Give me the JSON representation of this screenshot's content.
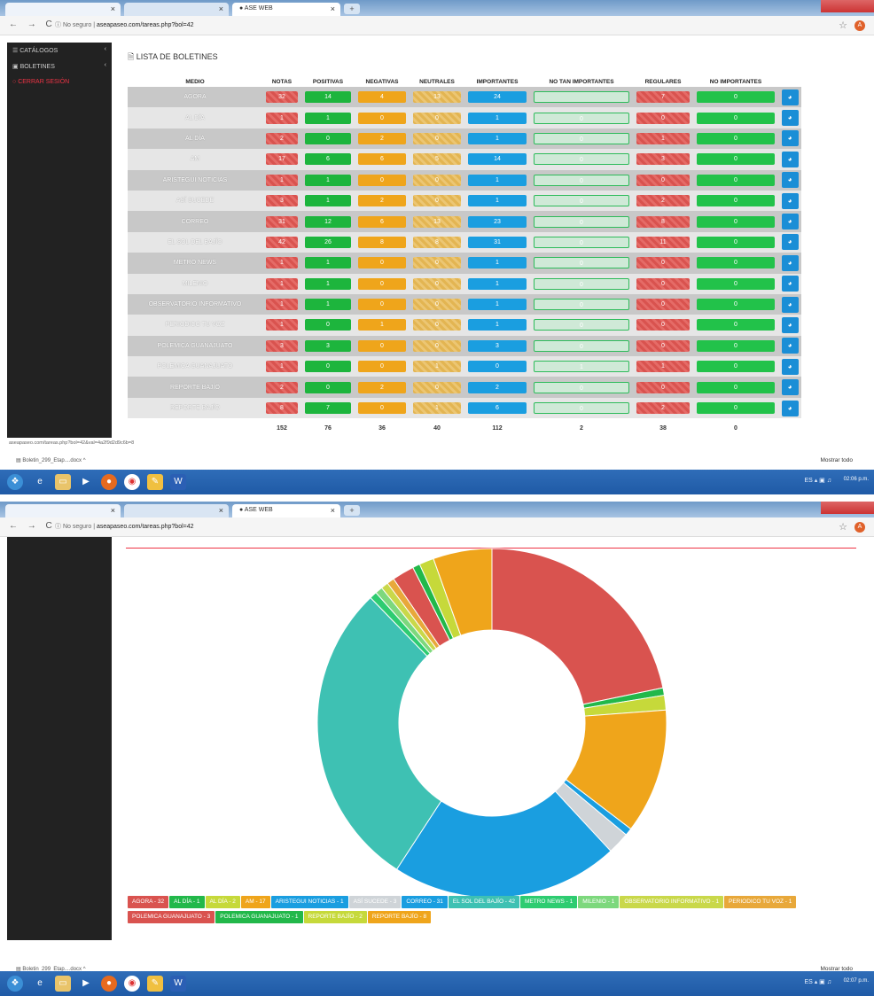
{
  "browser": {
    "tab_title": "ASE WEB",
    "url_prefix": "No seguro | ",
    "url1": "aseapaseo.com/tareas.php?bol=42",
    "url2": "aseapaseo.com/tareas.php?bol=42"
  },
  "sidebar": {
    "items": [
      {
        "label": "CATÁLOGOS"
      },
      {
        "label": "BOLETINES"
      },
      {
        "label": "CERRAR SESIÓN"
      }
    ]
  },
  "page": {
    "title": "LISTA DE BOLETINES"
  },
  "table": {
    "headers": [
      "MEDIO",
      "NOTAS",
      "POSITIVAS",
      "NEGATIVAS",
      "NEUTRALES",
      "IMPORTANTES",
      "NO TAN IMPORTANTES",
      "REGULARES",
      "NO IMPORTANTES"
    ],
    "rows": [
      {
        "medio": "AGORA",
        "vals": [
          "32",
          "14",
          "4",
          "13",
          "24",
          "",
          "7",
          "0"
        ]
      },
      {
        "medio": "AL DÍA",
        "vals": [
          "1",
          "1",
          "0",
          "0",
          "1",
          "0",
          "0",
          "0"
        ]
      },
      {
        "medio": "AL DÍA",
        "vals": [
          "2",
          "0",
          "2",
          "0",
          "1",
          "0",
          "1",
          "0"
        ]
      },
      {
        "medio": "AM",
        "vals": [
          "17",
          "6",
          "6",
          "5",
          "14",
          "0",
          "3",
          "0"
        ]
      },
      {
        "medio": "ARISTEGUI NOTICIAS",
        "vals": [
          "1",
          "1",
          "0",
          "0",
          "1",
          "0",
          "0",
          "0"
        ]
      },
      {
        "medio": "ASÍ SUCEDE",
        "vals": [
          "3",
          "1",
          "2",
          "0",
          "1",
          "0",
          "2",
          "0"
        ]
      },
      {
        "medio": "CORREO",
        "vals": [
          "31",
          "12",
          "6",
          "13",
          "23",
          "0",
          "8",
          "0"
        ]
      },
      {
        "medio": "EL SOL DEL BAJÍO",
        "vals": [
          "42",
          "26",
          "8",
          "8",
          "31",
          "0",
          "11",
          "0"
        ]
      },
      {
        "medio": "METRO NEWS",
        "vals": [
          "1",
          "1",
          "0",
          "0",
          "1",
          "0",
          "0",
          "0"
        ]
      },
      {
        "medio": "MILENIO",
        "vals": [
          "1",
          "1",
          "0",
          "0",
          "1",
          "0",
          "0",
          "0"
        ]
      },
      {
        "medio": "OBSERVATORIO INFORMATIVO",
        "vals": [
          "1",
          "1",
          "0",
          "0",
          "1",
          "0",
          "0",
          "0"
        ]
      },
      {
        "medio": "PERIODICO TU VOZ",
        "vals": [
          "1",
          "0",
          "1",
          "0",
          "1",
          "0",
          "0",
          "0"
        ]
      },
      {
        "medio": "POLEMICA GUANAJUATO",
        "vals": [
          "3",
          "3",
          "0",
          "0",
          "3",
          "0",
          "0",
          "0"
        ]
      },
      {
        "medio": "POLEMICA GUANAJUATO",
        "vals": [
          "1",
          "0",
          "0",
          "1",
          "0",
          "1",
          "1",
          "0"
        ]
      },
      {
        "medio": "REPORTE BAJÍO",
        "vals": [
          "2",
          "0",
          "2",
          "0",
          "2",
          "0",
          "0",
          "0"
        ]
      },
      {
        "medio": "REPORTE BAJÍO",
        "vals": [
          "8",
          "7",
          "0",
          "1",
          "6",
          "0",
          "2",
          "0"
        ]
      }
    ],
    "totals": [
      "152",
      "76",
      "36",
      "40",
      "112",
      "2",
      "38",
      "0"
    ]
  },
  "status": {
    "hover_url": "aseapaseo.com/tareas.php?bol=42&val=4a2f9d2d9c6b=8"
  },
  "downloads": {
    "file": "Boletin_299_Etap....docx",
    "show_all": "Mostrar todo"
  },
  "taskbar": {
    "tray": "ES",
    "clock1": "02:06 p.m.",
    "clock2": "02:07 p.m."
  },
  "chart_data": {
    "type": "pie",
    "donut": true,
    "categories": [
      "AGORA",
      "AL DÍA",
      "AL DÍA",
      "AM",
      "ARISTEGUI NOTICIAS",
      "ASÍ SUCEDE",
      "CORREO",
      "EL SOL DEL BAJÍO",
      "METRO NEWS",
      "MILENIO",
      "OBSERVATORIO INFORMATIVO",
      "PERIODICO TU VOZ",
      "POLEMICA GUANAJUATO",
      "POLEMICA GUANAJUATO",
      "REPORTE BAJÍO",
      "REPORTE BAJÍO"
    ],
    "values": [
      32,
      1,
      2,
      17,
      1,
      3,
      31,
      42,
      1,
      1,
      1,
      1,
      3,
      1,
      2,
      8
    ],
    "legend_labels": [
      "AGORA - 32",
      "AL DÍA - 1",
      "AL DÍA - 2",
      "AM - 17",
      "ARISTEGUI NOTICIAS - 1",
      "ASÍ SUCEDE - 3",
      "CORREO - 31",
      "EL SOL DEL BAJÍO - 42",
      "METRO NEWS - 1",
      "MILENIO - 1",
      "OBSERVATORIO INFORMATIVO - 1",
      "PERIODICO TU VOZ - 1",
      "POLEMICA GUANAJUATO - 3",
      "POLEMICA GUANAJUATO - 1",
      "REPORTE BAJÍO - 2",
      "REPORTE BAJÍO - 8"
    ],
    "colors": [
      "#d9534f",
      "#22b84a",
      "#c6d93a",
      "#efa51b",
      "#1a9ee0",
      "#cfd4d8",
      "#1a9ee0",
      "#3ec1b3",
      "#2ecc71",
      "#7dd87d",
      "#c9d84a",
      "#e8a83a",
      "#d9534f",
      "#22b84a",
      "#c6d93a",
      "#efa51b"
    ],
    "legend_position": "bottom"
  }
}
